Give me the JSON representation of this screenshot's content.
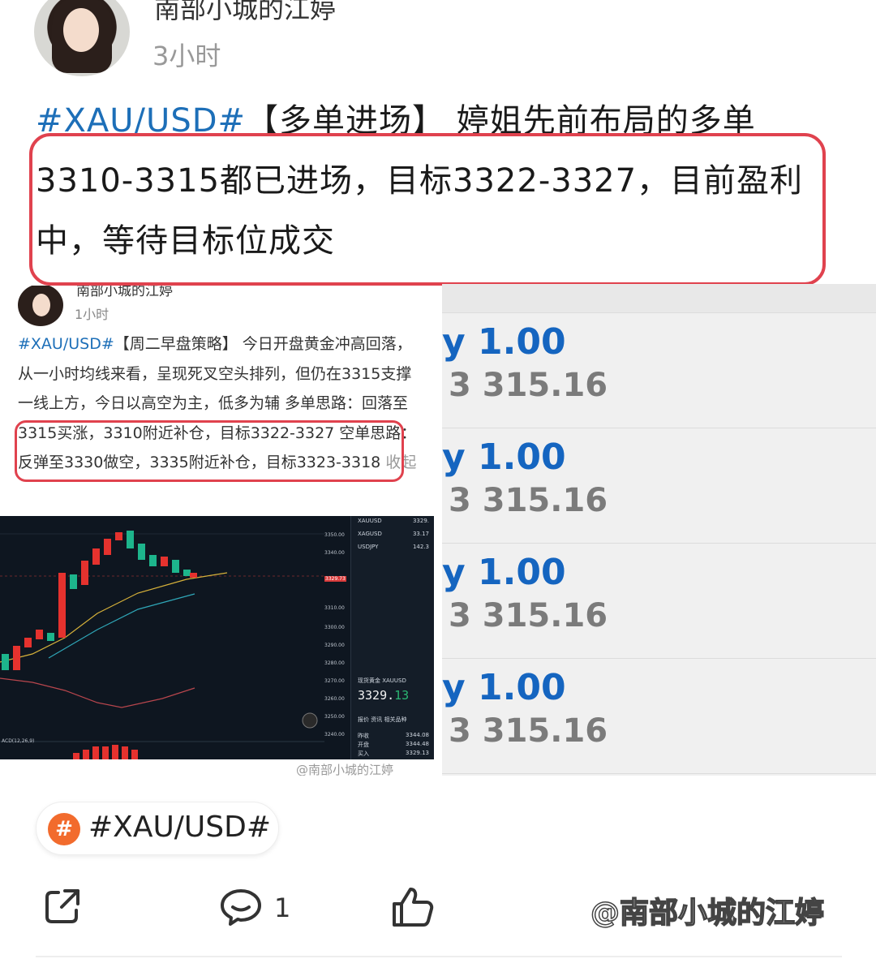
{
  "post": {
    "author": "南部小城的江婷",
    "time": "3小时",
    "tag": "#XAU/USD#",
    "text": "【多单进场】 婷姐先前布局的多单3310-3315都已进场，目标3322-3327，目前盈利中，等待目标位成交"
  },
  "embedded_post": {
    "author": "南部小城的江婷",
    "time": "1小时",
    "tag": "#XAU/USD#",
    "text": "【周二早盘策略】 今日开盘黄金冲高回落，从一小时均线来看，呈现死叉空头排列，但仍在3315支撑一线上方，今日以高空为主，低多为辅 多单思路：回落至3315买涨，3310附近补仓，目标3322-3327 空单思路：反弹至3330做空，3335附近补仓，目标3323-3318",
    "collapse": "收起",
    "watermark": "@南部小城的江婷"
  },
  "chart_panel": {
    "price_ticks": [
      "3350.00",
      "3340.00",
      "3329.73",
      "3310.00",
      "3300.00",
      "3290.00",
      "3280.00",
      "3270.00",
      "3260.00",
      "3250.00",
      "3240.00"
    ],
    "indicator_label": "ACD(12,26,9)",
    "watchlist": [
      {
        "symbol": "XAUUSD",
        "value": "3329."
      },
      {
        "symbol": "XAGUSD",
        "value": "33.17"
      },
      {
        "symbol": "USDJPY",
        "value": "142.3"
      }
    ],
    "quote_title": "现货黄金 XAUUSD",
    "quote_int": "3329.",
    "quote_dec": "13",
    "tabs": "报价  资讯  相关品种",
    "stats": [
      {
        "label": "昨收",
        "value": "3344.08"
      },
      {
        "label": "开盘",
        "value": "3344.48"
      },
      {
        "label": "买入",
        "value": "3329.13"
      }
    ]
  },
  "orders": [
    {
      "lot": "y 1.00",
      "price": "3 315.16"
    },
    {
      "lot": "y 1.00",
      "price": "3 315.16"
    },
    {
      "lot": "y 1.00",
      "price": "3 315.16"
    },
    {
      "lot": "y 1.00",
      "price": "3 315.16"
    }
  ],
  "topic": {
    "label": "#XAU/USD#",
    "icon": "#"
  },
  "actions": {
    "comment_count": "1"
  },
  "watermark": "@南部小城的江婷",
  "colors": {
    "tag_blue": "#1d6fb8",
    "highlight_red": "#e0424e",
    "topic_orange": "#f26b2d",
    "lot_blue": "#1565c0"
  }
}
